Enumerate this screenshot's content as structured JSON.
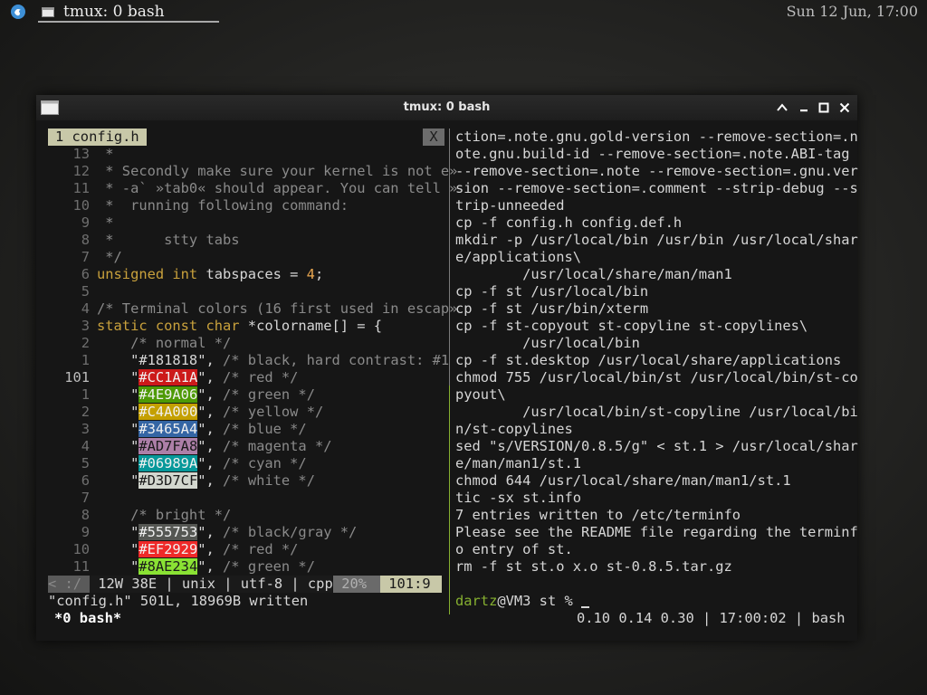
{
  "topbar": {
    "task_title": "tmux: 0 bash",
    "clock": "Sun 12 Jun, 17:00"
  },
  "window": {
    "title": "tmux: 0 bash",
    "controls": [
      "chevron-up-icon",
      "close-icon",
      "maximize-icon",
      "close-icon"
    ]
  },
  "vim": {
    "tab_label": "1 config.h",
    "tab_close": "X",
    "lines": [
      {
        "n": "13",
        "segs": [
          {
            "c": "cm",
            "t": " *"
          }
        ]
      },
      {
        "n": "12",
        "segs": [
          {
            "c": "cm",
            "t": " * Secondly make sure your kernel is not e»"
          }
        ]
      },
      {
        "n": "11",
        "segs": [
          {
            "c": "cm",
            "t": " * -a` »tab0« should appear. You can tell »"
          }
        ]
      },
      {
        "n": "10",
        "segs": [
          {
            "c": "cm",
            "t": " *  running following command:"
          }
        ]
      },
      {
        "n": "9",
        "segs": [
          {
            "c": "cm",
            "t": " *"
          }
        ]
      },
      {
        "n": "8",
        "segs": [
          {
            "c": "cm",
            "t": " *      stty tabs"
          }
        ]
      },
      {
        "n": "7",
        "segs": [
          {
            "c": "cm",
            "t": " */"
          }
        ]
      },
      {
        "n": "6",
        "segs": [
          {
            "c": "kw",
            "t": "unsigned int"
          },
          {
            "c": "tx",
            "t": " tabspaces = "
          },
          {
            "c": "num",
            "t": "4"
          },
          {
            "c": "tx",
            "t": ";"
          }
        ]
      },
      {
        "n": "5",
        "segs": []
      },
      {
        "n": "4",
        "segs": [
          {
            "c": "cm",
            "t": "/* Terminal colors (16 first used in escap»"
          }
        ]
      },
      {
        "n": "3",
        "segs": [
          {
            "c": "kw",
            "t": "static const char"
          },
          {
            "c": "tx",
            "t": " *colorname[] = {"
          }
        ]
      },
      {
        "n": "2",
        "segs": [
          {
            "c": "cm",
            "t": "    /* normal */"
          }
        ]
      },
      {
        "n": "1",
        "segs": [
          {
            "c": "tx",
            "t": "    \"#181818\", "
          },
          {
            "c": "cm",
            "t": "/* black, hard contrast: #1"
          }
        ]
      },
      {
        "n": "101",
        "cur": true,
        "segs": [
          {
            "c": "tx",
            "t": "    \""
          },
          {
            "c": "hl",
            "bg": "#CC1A1A",
            "fg": "#f0f0f0",
            "t": "#CC1A1A"
          },
          {
            "c": "tx",
            "t": "\", "
          },
          {
            "c": "cm",
            "t": "/* red */"
          }
        ]
      },
      {
        "n": "1",
        "segs": [
          {
            "c": "tx",
            "t": "    \""
          },
          {
            "c": "hl",
            "bg": "#4E9A06",
            "fg": "#f0f0f0",
            "t": "#4E9A06"
          },
          {
            "c": "tx",
            "t": "\", "
          },
          {
            "c": "cm",
            "t": "/* green */"
          }
        ]
      },
      {
        "n": "2",
        "segs": [
          {
            "c": "tx",
            "t": "    \""
          },
          {
            "c": "hl",
            "bg": "#C4A000",
            "fg": "#f0f0f0",
            "t": "#C4A000"
          },
          {
            "c": "tx",
            "t": "\", "
          },
          {
            "c": "cm",
            "t": "/* yellow */"
          }
        ]
      },
      {
        "n": "3",
        "segs": [
          {
            "c": "tx",
            "t": "    \""
          },
          {
            "c": "hl",
            "bg": "#3465A4",
            "fg": "#f0f0f0",
            "t": "#3465A4"
          },
          {
            "c": "tx",
            "t": "\", "
          },
          {
            "c": "cm",
            "t": "/* blue */"
          }
        ]
      },
      {
        "n": "4",
        "segs": [
          {
            "c": "tx",
            "t": "    \""
          },
          {
            "c": "hl",
            "bg": "#AD7FA8",
            "fg": "#1a1a1a",
            "t": "#AD7FA8"
          },
          {
            "c": "tx",
            "t": "\", "
          },
          {
            "c": "cm",
            "t": "/* magenta */"
          }
        ]
      },
      {
        "n": "5",
        "segs": [
          {
            "c": "tx",
            "t": "    \""
          },
          {
            "c": "hl",
            "bg": "#06989A",
            "fg": "#f0f0f0",
            "t": "#06989A"
          },
          {
            "c": "tx",
            "t": "\", "
          },
          {
            "c": "cm",
            "t": "/* cyan */"
          }
        ]
      },
      {
        "n": "6",
        "segs": [
          {
            "c": "tx",
            "t": "    \""
          },
          {
            "c": "hl",
            "bg": "#D3D7CF",
            "fg": "#1a1a1a",
            "t": "#D3D7CF"
          },
          {
            "c": "tx",
            "t": "\", "
          },
          {
            "c": "cm",
            "t": "/* white */"
          }
        ]
      },
      {
        "n": "7",
        "segs": []
      },
      {
        "n": "8",
        "segs": [
          {
            "c": "cm",
            "t": "    /* bright */"
          }
        ]
      },
      {
        "n": "9",
        "segs": [
          {
            "c": "tx",
            "t": "    \""
          },
          {
            "c": "hl",
            "bg": "#555753",
            "fg": "#f0f0f0",
            "t": "#555753"
          },
          {
            "c": "tx",
            "t": "\", "
          },
          {
            "c": "cm",
            "t": "/* black/gray */"
          }
        ]
      },
      {
        "n": "10",
        "segs": [
          {
            "c": "tx",
            "t": "    \""
          },
          {
            "c": "hl",
            "bg": "#EF2929",
            "fg": "#f0f0f0",
            "t": "#EF2929"
          },
          {
            "c": "tx",
            "t": "\", "
          },
          {
            "c": "cm",
            "t": "/* red */"
          }
        ]
      },
      {
        "n": "11",
        "segs": [
          {
            "c": "tx",
            "t": "    \""
          },
          {
            "c": "hl",
            "bg": "#8AE234",
            "fg": "#1a1a1a",
            "t": "#8AE234"
          },
          {
            "c": "tx",
            "t": "\", "
          },
          {
            "c": "cm",
            "t": "/* green */"
          }
        ]
      }
    ],
    "status": {
      "mode": "< :/",
      "info": " 12W 38E | unix | utf-8 | cpp ",
      "percent": " 20% ",
      "position": " 101:9 "
    },
    "message": "\"config.h\" 501L, 18969B written"
  },
  "shell": {
    "lines": [
      "ction=.note.gnu.gold-version --remove-section=.n",
      "ote.gnu.build-id --remove-section=.note.ABI-tag",
      "--remove-section=.note --remove-section=.gnu.ver",
      "sion --remove-section=.comment --strip-debug --s",
      "trip-unneeded",
      "cp -f config.h config.def.h",
      "mkdir -p /usr/local/bin /usr/bin /usr/local/shar",
      "e/applications\\",
      "        /usr/local/share/man/man1",
      "cp -f st /usr/local/bin",
      "cp -f st /usr/bin/xterm",
      "cp -f st-copyout st-copyline st-copylines\\",
      "        /usr/local/bin",
      "cp -f st.desktop /usr/local/share/applications",
      "chmod 755 /usr/local/bin/st /usr/local/bin/st-co",
      "pyout\\",
      "        /usr/local/bin/st-copyline /usr/local/bi",
      "n/st-copylines",
      "sed \"s/VERSION/0.8.5/g\" < st.1 > /usr/local/shar",
      "e/man/man1/st.1",
      "chmod 644 /usr/local/share/man/man1/st.1",
      "tic -sx st.info",
      "7 entries written to /etc/terminfo",
      "Please see the README file regarding the terminf",
      "o entry of st.",
      "rm -f st st.o x.o st-0.8.5.tar.gz",
      ""
    ],
    "prompt_user": "dartz",
    "prompt_rest": "@VM3 st % "
  },
  "tmux": {
    "window_label": "*0 bash*",
    "right_status": "0.10 0.14 0.30 | 17:00:02 | bash"
  },
  "colors": {
    "prompt_green": "#86b030",
    "keyword": "#c9a13c",
    "comment": "#8a8a8a"
  }
}
